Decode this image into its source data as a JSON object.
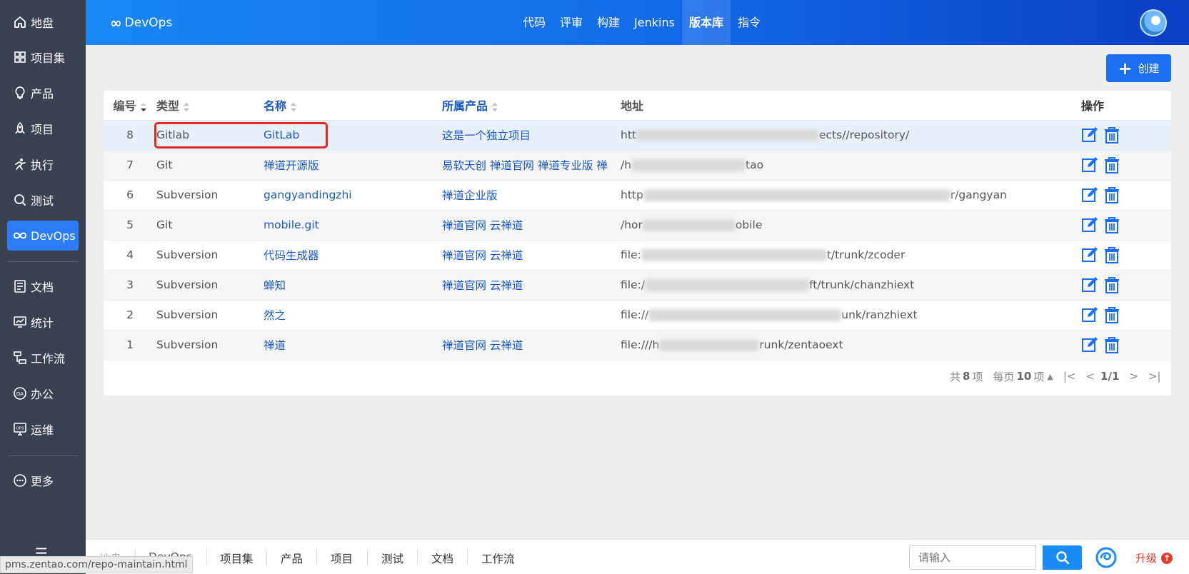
{
  "sidebar": {
    "items": [
      {
        "label": "地盘",
        "icon": "home-icon"
      },
      {
        "label": "项目集",
        "icon": "grid-icon"
      },
      {
        "label": "产品",
        "icon": "lightbulb-icon"
      },
      {
        "label": "项目",
        "icon": "rocket-icon"
      },
      {
        "label": "执行",
        "icon": "run-icon"
      },
      {
        "label": "测试",
        "icon": "search-test-icon"
      },
      {
        "label": "DevOps",
        "icon": "infinity-icon"
      },
      {
        "label": "文档",
        "icon": "doc-icon"
      },
      {
        "label": "统计",
        "icon": "monitor-icon"
      },
      {
        "label": "工作流",
        "icon": "workflow-icon"
      },
      {
        "label": "办公",
        "icon": "oa-icon"
      },
      {
        "label": "运维",
        "icon": "ops-icon"
      },
      {
        "label": "更多",
        "icon": "more-icon"
      }
    ]
  },
  "header": {
    "brand": "DevOps",
    "tabs": [
      "代码",
      "评审",
      "构建",
      "Jenkins",
      "版本库",
      "指令"
    ],
    "active_tab": "版本库"
  },
  "toolbar": {
    "create_label": "创建"
  },
  "table": {
    "columns": [
      "编号",
      "类型",
      "名称",
      "所属产品",
      "地址",
      "操作"
    ],
    "rows": [
      {
        "id": "8",
        "type": "Gitlab",
        "name": "GitLab",
        "product": "这是一个独立项目",
        "addr_pre": "htt",
        "addr_post": "ects//repository/"
      },
      {
        "id": "7",
        "type": "Git",
        "name": "禅道开源版",
        "product": "易软天创 禅道官网 禅道专业版 禅",
        "addr_pre": "/h",
        "addr_post": "tao"
      },
      {
        "id": "6",
        "type": "Subversion",
        "name": "gangyandingzhi",
        "product": "禅道企业版",
        "addr_pre": "http",
        "addr_post": "r/gangyan"
      },
      {
        "id": "5",
        "type": "Git",
        "name": "mobile.git",
        "product": "禅道官网 云禅道",
        "addr_pre": "/hor",
        "addr_post": "obile"
      },
      {
        "id": "4",
        "type": "Subversion",
        "name": "代码生成器",
        "product": "禅道官网 云禅道",
        "addr_pre": "file:",
        "addr_post": "t/trunk/zcoder"
      },
      {
        "id": "3",
        "type": "Subversion",
        "name": "蝉知",
        "product": "禅道官网 云禅道",
        "addr_pre": "file:/",
        "addr_post": "ft/trunk/chanzhiext"
      },
      {
        "id": "2",
        "type": "Subversion",
        "name": "然之",
        "product": "",
        "addr_pre": "file://",
        "addr_post": "unk/ranzhiext"
      },
      {
        "id": "1",
        "type": "Subversion",
        "name": "禅道",
        "product": "禅道官网 云禅道",
        "addr_pre": "file:///h",
        "addr_post": "runk/zentaoext"
      }
    ]
  },
  "pager": {
    "total_prefix": "共",
    "total": "8",
    "total_suffix": "项",
    "per_page_prefix": "每页",
    "per_page": "10",
    "per_page_suffix": "项",
    "page": "1/1"
  },
  "bottombar": {
    "items": [
      "地盘",
      "DevOps",
      "项目集",
      "产品",
      "项目",
      "测试",
      "文档",
      "工作流"
    ],
    "search_placeholder": "请输入",
    "upgrade_label": "升级"
  },
  "status_url": "pms.zentao.com/repo-maintain.html",
  "colors": {
    "accent": "#1a6ef0",
    "sidebar": "#3a4150",
    "active": "#2b7cf6",
    "link": "#1958c8",
    "highlight_box": "#e8261e"
  }
}
